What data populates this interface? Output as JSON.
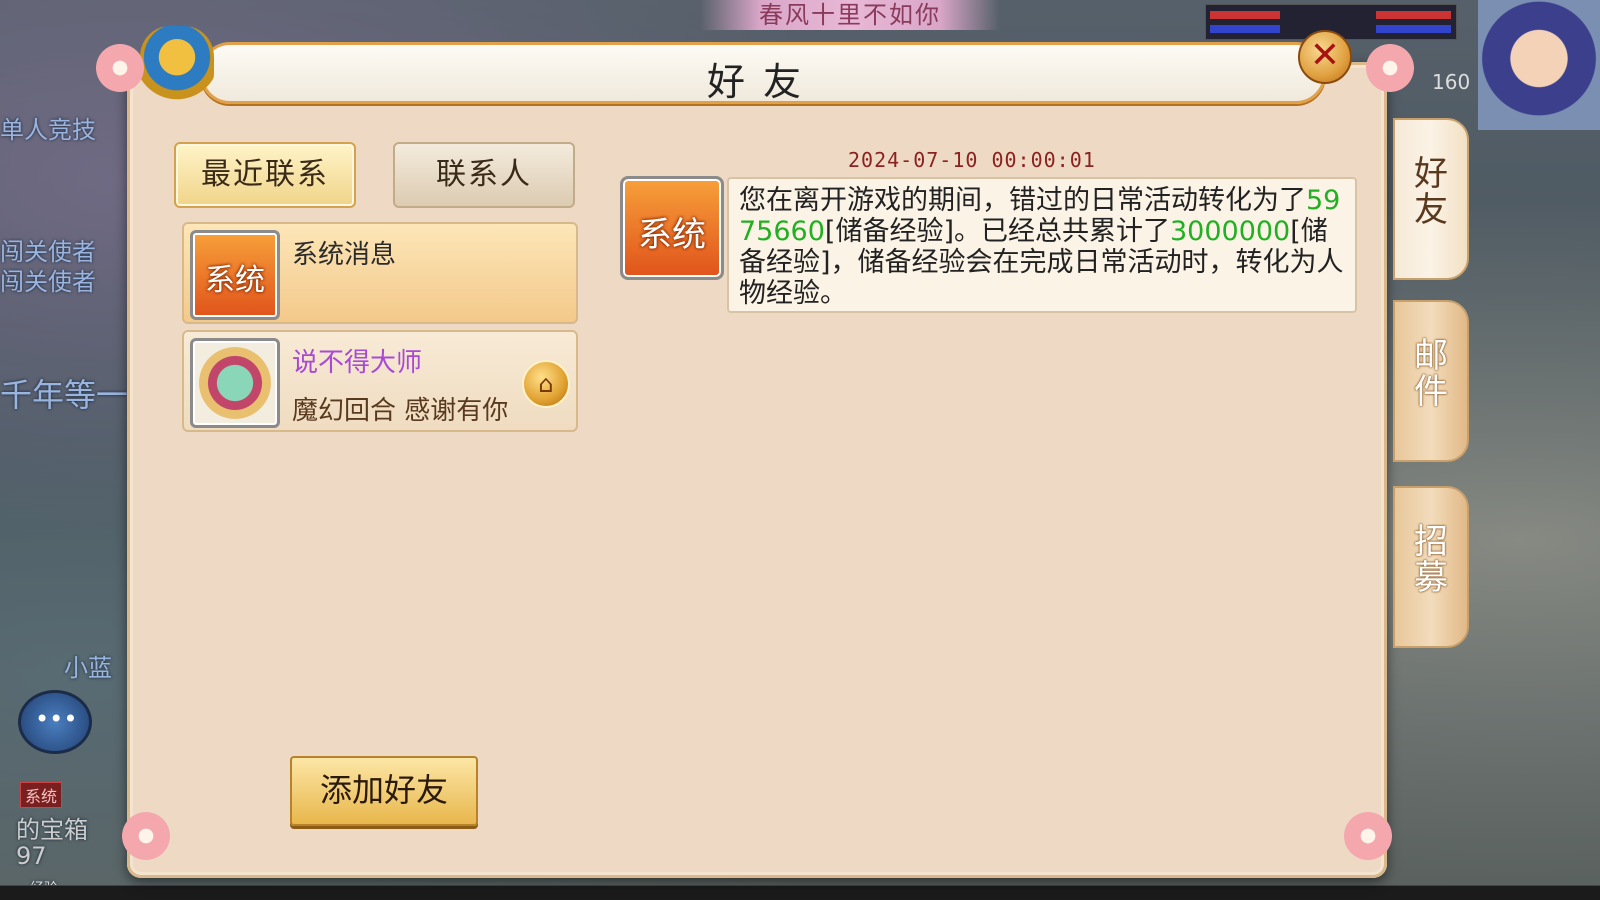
{
  "background": {
    "top_banner": "春风十里不如你",
    "level": "160",
    "left_texts": [
      "单人竞技",
      "闯关使者",
      "闯关使者",
      "千年等一",
      "小蓝"
    ],
    "sys_tag": "系统",
    "bottom_left": [
      "的宝箱",
      "97",
      "经验"
    ]
  },
  "dialog": {
    "title": "好友",
    "close_glyph": "✕",
    "tabs": {
      "recent": "最近联系",
      "contacts": "联系人"
    },
    "contacts": [
      {
        "avatar_text": "系统",
        "name": "系统消息",
        "subtitle": ""
      },
      {
        "avatar_text": "",
        "name": "说不得大师",
        "subtitle": "魔幻回合  感谢有你"
      }
    ],
    "message": {
      "timestamp": "2024-07-10  00:00:01",
      "avatar_text": "系统",
      "text_1": "您在离开游戏的期间，错过的日常活动转化为了",
      "value_1": "5975660",
      "text_2": "[储备经验]。已经总共累计了",
      "value_2": "3000000",
      "text_3": "[储备经验]，储备经验会在完成日常活动时，转化为人物经验。"
    },
    "add_friend": "添加好友",
    "side_tabs": [
      "好友",
      "邮件",
      "招募"
    ]
  },
  "colors": {
    "accent_orange": "#e1a04a",
    "green_value": "#22b022",
    "purple_name": "#a84ad4",
    "timestamp_red": "#8a2222"
  }
}
